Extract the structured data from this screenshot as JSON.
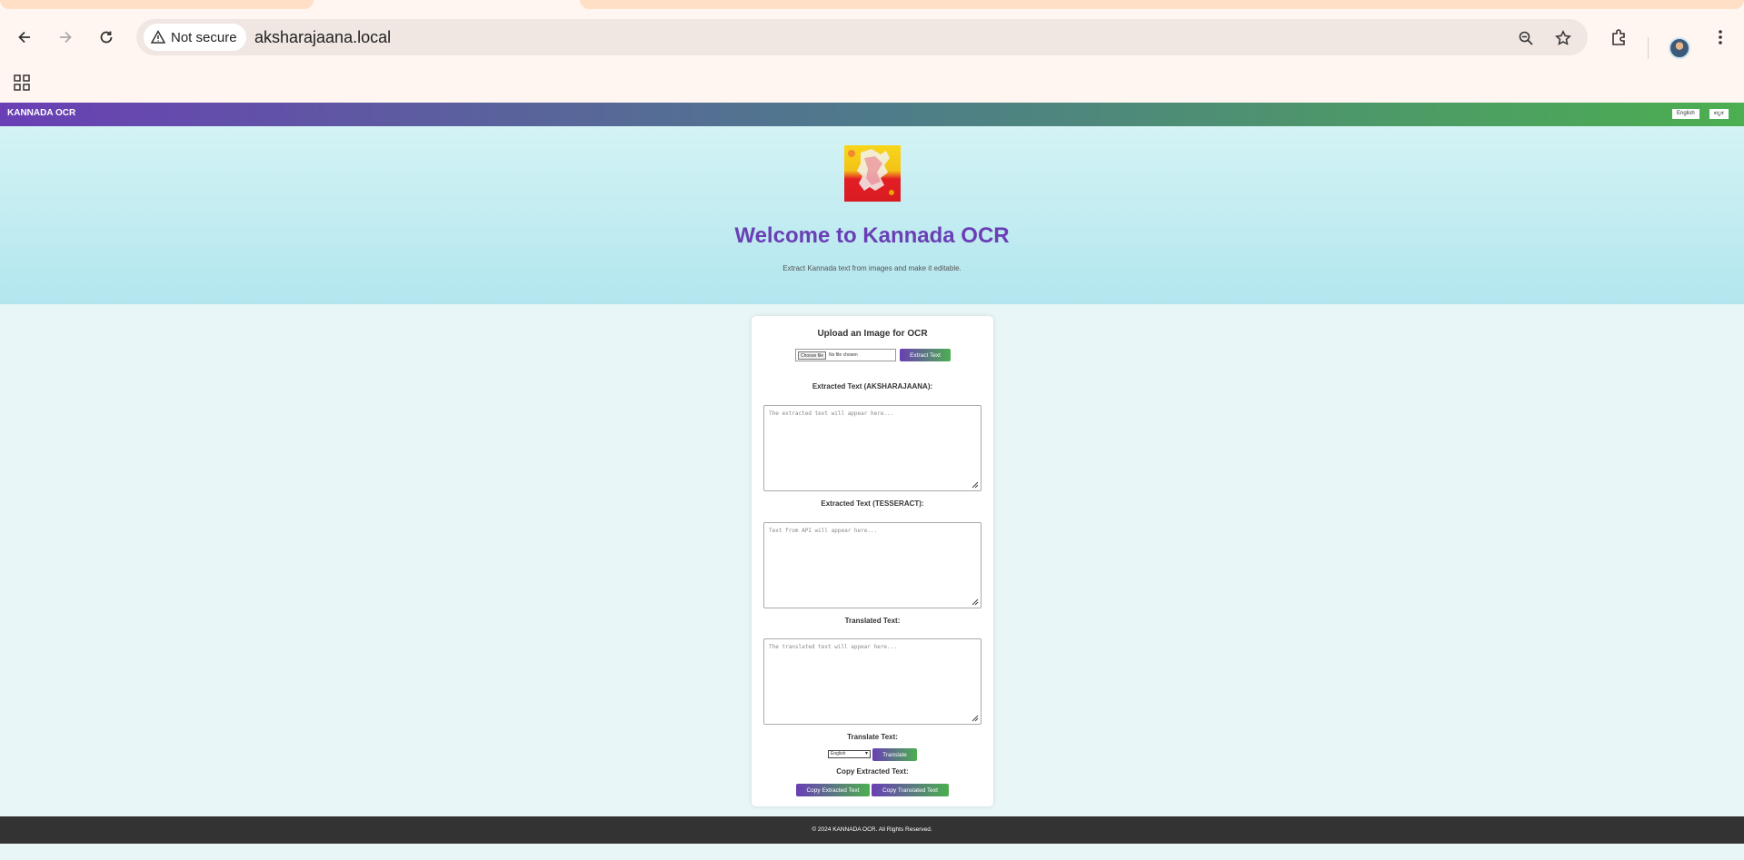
{
  "browser": {
    "security_label": "Not secure",
    "url": "aksharajaana.local"
  },
  "site": {
    "brand": "KANNADA OCR",
    "lang_english": "English",
    "lang_kannada": "ಕನ್ನಡ",
    "hero_title": "Welcome to Kannada OCR",
    "hero_subtitle": "Extract Kannada text from images and make it editable."
  },
  "upload": {
    "title": "Upload an Image for OCR",
    "choose_file": "Choose file",
    "no_file": "No file chosen",
    "extract_button": "Extract Text"
  },
  "sections": {
    "aksharajaana_label": "Extracted Text (AKSHARAJAANA):",
    "aksharajaana_placeholder": "The extracted text will appear here...",
    "tesseract_label": "Extracted Text (TESSERACT):",
    "tesseract_placeholder": "Text from API will appear here...",
    "translated_label": "Translated Text:",
    "translated_placeholder": "The translated text will appear here...",
    "translate_label": "Translate Text:",
    "translate_select_value": "English",
    "translate_button": "Translate",
    "copy_label": "Copy Extracted Text:",
    "copy_extracted_button": "Copy Extracted Text",
    "copy_translated_button": "Copy Translated Text"
  },
  "footer": {
    "text": "© 2024 KANNADA OCR. All Rights Reserved."
  },
  "colors": {
    "brand_purple": "#6a3fb5",
    "brand_green": "#4caf50",
    "footer_bg": "#333333"
  }
}
